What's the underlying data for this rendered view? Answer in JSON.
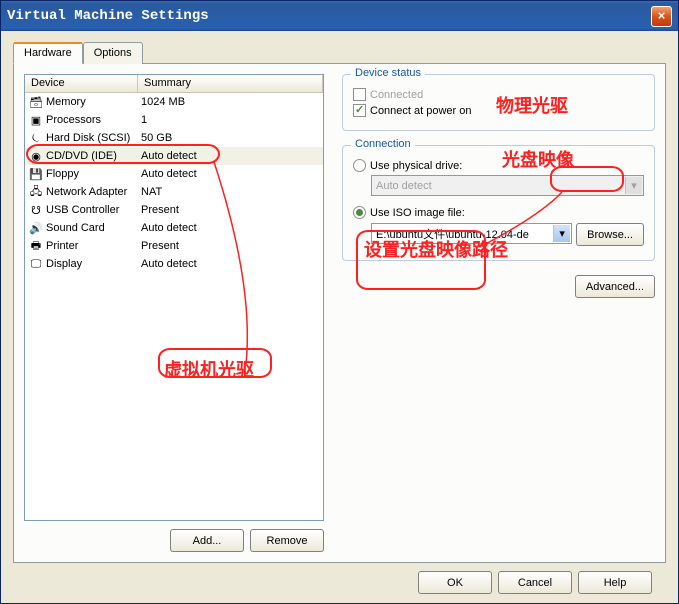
{
  "window_title": "Virtual Machine Settings",
  "tabs": {
    "hardware": "Hardware",
    "options": "Options"
  },
  "table": {
    "header_device": "Device",
    "header_summary": "Summary",
    "rows": [
      {
        "name": "Memory",
        "summary": "1024 MB"
      },
      {
        "name": "Processors",
        "summary": "1"
      },
      {
        "name": "Hard Disk (SCSI)",
        "summary": "50 GB"
      },
      {
        "name": "CD/DVD (IDE)",
        "summary": "Auto detect"
      },
      {
        "name": "Floppy",
        "summary": "Auto detect"
      },
      {
        "name": "Network Adapter",
        "summary": "NAT"
      },
      {
        "name": "USB Controller",
        "summary": "Present"
      },
      {
        "name": "Sound Card",
        "summary": "Auto detect"
      },
      {
        "name": "Printer",
        "summary": "Present"
      },
      {
        "name": "Display",
        "summary": "Auto detect"
      }
    ]
  },
  "buttons": {
    "add": "Add...",
    "remove": "Remove",
    "ok": "OK",
    "cancel": "Cancel",
    "help": "Help",
    "browse": "Browse...",
    "advanced": "Advanced..."
  },
  "device_status": {
    "title": "Device status",
    "connected": "Connected",
    "connect_power": "Connect at power on"
  },
  "connection": {
    "title": "Connection",
    "physical": "Use physical drive:",
    "physical_value": "Auto detect",
    "iso": "Use ISO image file:",
    "iso_value": "E:\\ubuntu文件\\ubuntu-12.04-de"
  },
  "annotations": {
    "vm_drive": "虚拟机光驱",
    "physical_drive": "物理光驱",
    "iso_image": "光盘映像",
    "set_iso_path": "设置光盘映像路径"
  }
}
